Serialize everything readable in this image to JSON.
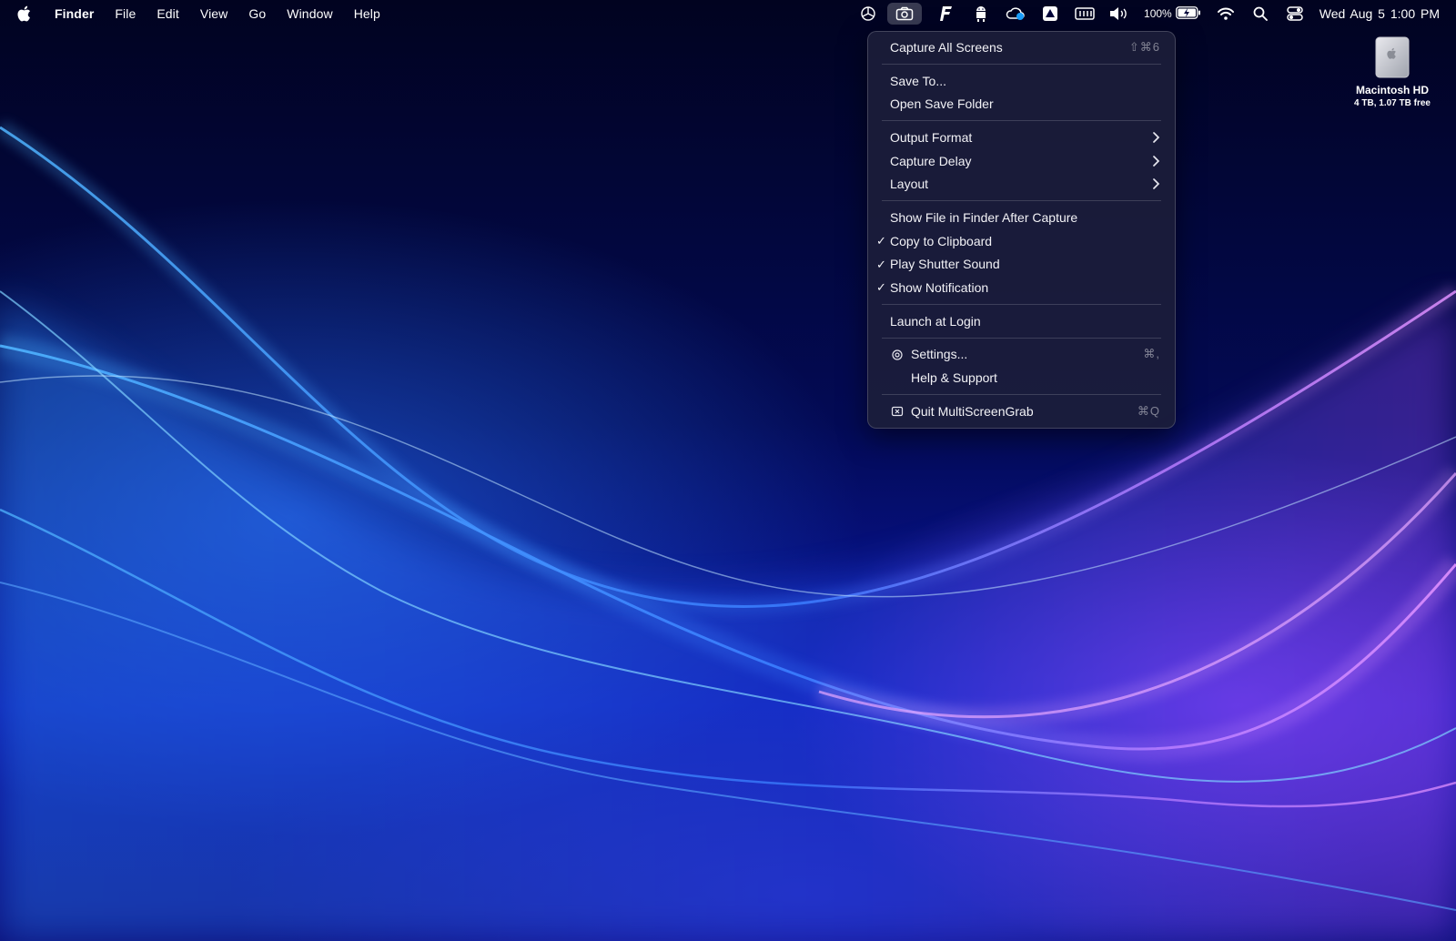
{
  "menubar": {
    "app_name": "Finder",
    "menus": [
      "File",
      "Edit",
      "View",
      "Go",
      "Window",
      "Help"
    ],
    "status_icons": [
      "openai-icon",
      "camera-icon",
      "f-app-icon",
      "android-icon",
      "cloud-sync-icon",
      "drive-icon",
      "memory-icon",
      "volume-icon"
    ],
    "battery_percent": "100%",
    "clock": "Wed Aug 5  1:00 PM"
  },
  "dropdown": {
    "capture_all": {
      "label": "Capture All Screens",
      "shortcut": "⇧⌘6"
    },
    "save_to": "Save To...",
    "open_save_folder": "Open Save Folder",
    "output_format": "Output Format",
    "capture_delay": "Capture Delay",
    "layout": "Layout",
    "show_in_finder": "Show File in Finder After Capture",
    "copy_clipboard": "Copy to Clipboard",
    "play_shutter": "Play Shutter Sound",
    "show_notification": "Show Notification",
    "launch_login": "Launch at Login",
    "settings": {
      "label": "Settings...",
      "shortcut": "⌘,"
    },
    "help": "Help & Support",
    "quit": {
      "label": "Quit MultiScreenGrab",
      "shortcut": "⌘Q"
    },
    "checkmark": "✓"
  },
  "desktop": {
    "disk_name": "Macintosh HD",
    "disk_info": "4 TB, 1.07 TB free"
  },
  "colors": {
    "menu_bg": "#1c1e3a",
    "wallpaper_blue": "#0a17a8",
    "wallpaper_purple": "#aa46ff"
  }
}
